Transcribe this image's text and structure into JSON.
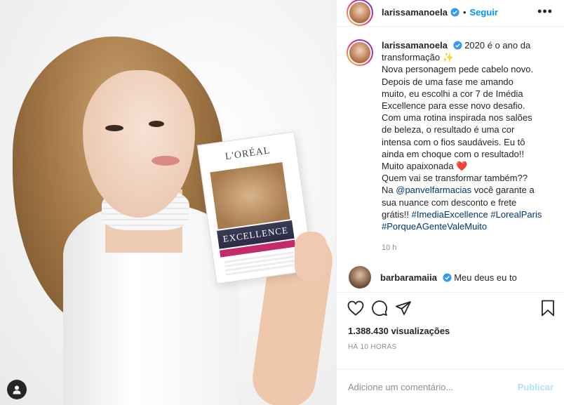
{
  "post": {
    "username": "larissamanoela",
    "follow_label": "Seguir",
    "separator": "•",
    "more_label": "•••",
    "caption_lines": [
      "2020 é o ano da",
      "transformação ✨",
      "Nova personagem pede cabelo novo.",
      "Depois de uma fase me amando",
      "muito, eu escolhi a cor 7 de Imédia",
      "Excellence para esse novo desafio.",
      "Com uma rotina inspirada nos salões",
      "de beleza, o resultado é uma cor",
      "intensa com o fios saudáveis. Eu tô",
      "ainda em choque com o resultado!!",
      "Muito apaixonada ❤️",
      "Quem vai se transformar também??"
    ],
    "caption_na": "Na",
    "caption_mention": "@panvelfarmacias",
    "caption_after_mention_1": " você garante a",
    "caption_after_mention_2": "sua nuance com desconto e frete",
    "caption_gratis": "grátis!!",
    "hashtags": [
      "#ImediaExcellence",
      "#LorealParis",
      "#PorqueAGenteValeMuito"
    ],
    "caption_time": "10 h",
    "next_comment_user": "barbaramaiia",
    "next_comment_text": "Meu deus eu to"
  },
  "product": {
    "brand": "L'ORÉAL",
    "name": "EXCELLENCE"
  },
  "stats": {
    "views": "1.388.430 visualizações",
    "ago": "HÁ 10 HORAS"
  },
  "comment_box": {
    "placeholder": "Adicione um comentário...",
    "publish_label": "Publicar"
  },
  "colors": {
    "link_blue": "#0095f6",
    "tag_blue": "#00376b",
    "publish_disabled": "#b2dffc",
    "verified": "#3897f0"
  },
  "icons": [
    "verified-badge-icon",
    "more-options-icon",
    "heart-icon",
    "comment-icon",
    "share-icon",
    "bookmark-icon",
    "user-tag-icon"
  ]
}
